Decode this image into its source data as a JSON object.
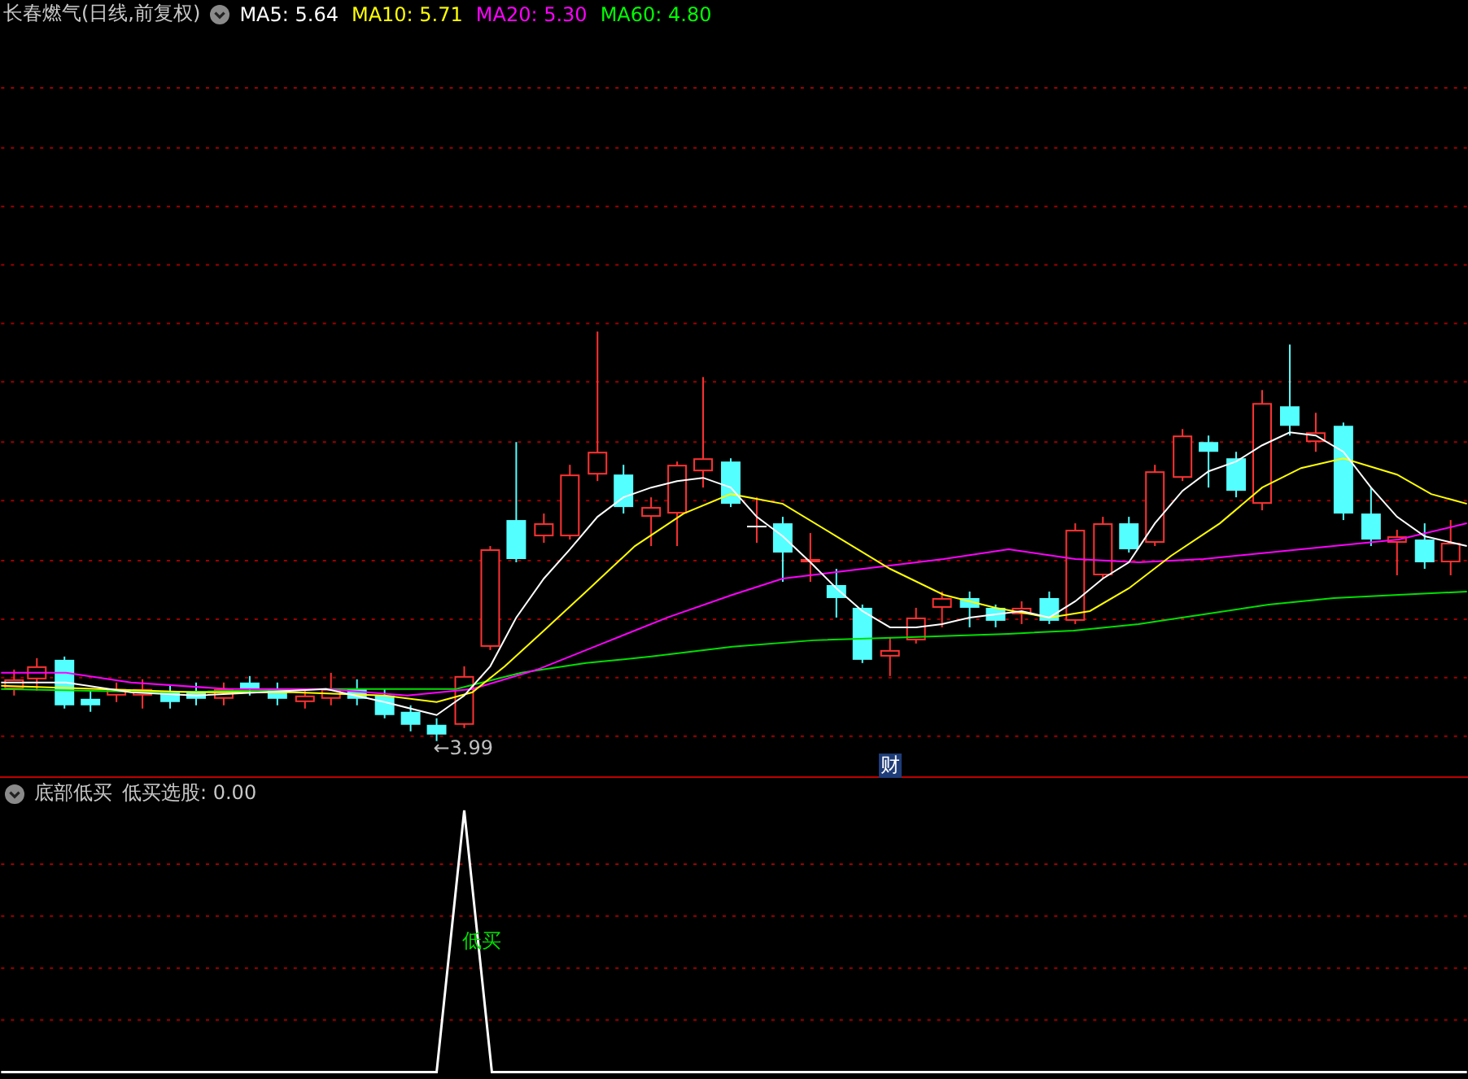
{
  "main_chart": {
    "title": "长春燃气(日线,前复权)",
    "ma_labels": [
      {
        "name": "MA5:",
        "value": "5.64",
        "color": "#ffffff"
      },
      {
        "name": "MA10:",
        "value": "5.71",
        "color": "#ffff00"
      },
      {
        "name": "MA20:",
        "value": "5.30",
        "color": "#ff00ff"
      },
      {
        "name": "MA60:",
        "value": "4.80",
        "color": "#00ff00"
      }
    ],
    "low_marker": "←3.99",
    "badge": "财"
  },
  "indicator": {
    "name": "底部低买",
    "reading": "低买选股: 0.00",
    "signal_label": "低买"
  }
}
